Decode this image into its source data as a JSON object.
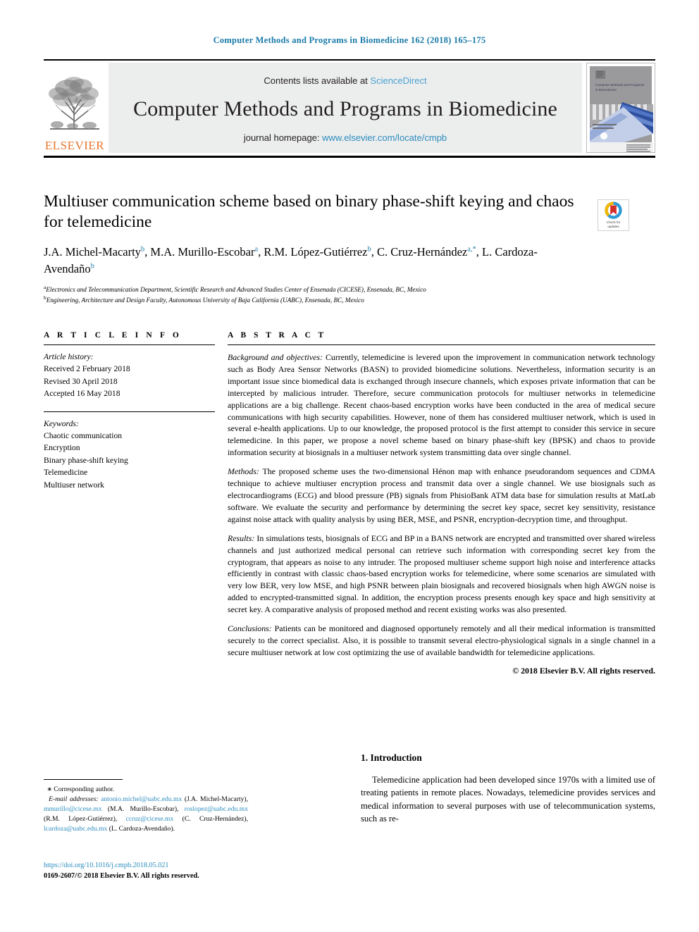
{
  "running_head": "Computer Methods and Programs in Biomedicine 162 (2018) 165–175",
  "masthead": {
    "contents_prefix": "Contents lists available at ",
    "sciencedirect": "ScienceDirect",
    "journal_title": "Computer Methods and Programs in Biomedicine",
    "homepage_prefix": "journal homepage: ",
    "homepage_url": "www.elsevier.com/locate/cmpb",
    "publisher": "ELSEVIER",
    "cover_title": "Computer Methods and Programs in Biomedicine"
  },
  "crossmark": {
    "line1": "Check for",
    "line2": "updates"
  },
  "article": {
    "title": "Multiuser communication scheme based on binary phase-shift keying and chaos for telemedicine",
    "authors_html": "J.A. Michel-Macarty<sup>b</sup>, M.A. Murillo-Escobar<sup>a</sup>, R.M. López-Gutiérrez<sup>b</sup>, C. Cruz-Hernández<sup>a,</sup><sup>*</sup>, L. Cardoza-Avendaño<sup>b</sup>",
    "affiliation_a": "Electronics and Telecommunication Department, Scientific Research and Advanced Studies Center of Ensenada (CICESE), Ensenada, BC, Mexico",
    "affiliation_b": "Engineering, Architecture and Design Faculty, Autonomous University of Baja California (UABC), Ensenada, BC, Mexico"
  },
  "info": {
    "heading": "A R T I C L E  I N F O",
    "history_label": "Article history:",
    "history": [
      "Received 2 February 2018",
      "Revised 30 April 2018",
      "Accepted 16 May 2018"
    ],
    "keywords_label": "Keywords:",
    "keywords": [
      "Chaotic communication",
      "Encryption",
      "Binary phase-shift keying",
      "Telemedicine",
      "Multiuser network"
    ]
  },
  "abstract": {
    "heading": "A B S T R A C T",
    "background_label": "Background and objectives:",
    "background_text": "  Currently, telemedicine is levered upon the improvement in communication network technology such as Body Area Sensor Networks (BASN) to provided biomedicine solutions. Nevertheless, information security is an important issue since biomedical data is exchanged through insecure channels, which exposes private information that can be intercepted by malicious intruder. Therefore, secure communication protocols for multiuser networks in telemedicine applications are a big challenge. Recent chaos-based encryption works have been conducted in the area of medical secure communications with high security capabilities. However, none of them has considered multiuser network, which is used in several e-health applications. Up to our knowledge, the proposed protocol is the first attempt to consider this service in secure telemedicine. In this paper, we propose a novel scheme based on binary phase-shift key (BPSK) and chaos to provide information security at biosignals in a multiuser network system transmitting data over single channel.",
    "methods_label": "Methods:",
    "methods_text": "  The proposed scheme uses the two-dimensional Hénon map with enhance pseudorandom sequences and CDMA technique to achieve multiuser encryption process and transmit data over a single channel. We use biosignals such as electrocardiograms (ECG) and blood pressure (PB) signals from PhisioBank ATM data base for simulation results at MatLab software. We evaluate the security and performance by determining the secret key space, secret key sensitivity, resistance against noise attack with quality analysis by using BER, MSE, and PSNR, encryption-decryption time, and throughput.",
    "results_label": "Results:",
    "results_text": "  In simulations tests, biosignals of ECG and BP in a BANS network are encrypted and transmitted over shared wireless channels and just authorized medical personal can retrieve such information with corresponding secret key from the cryptogram, that appears as noise to any intruder. The proposed multiuser scheme support high noise and interference attacks efficiently in contrast with classic chaos-based encryption works for telemedicine, where some scenarios are simulated with very low BER, very low MSE, and high PSNR between plain biosignals and recovered biosignals when high AWGN noise is added to encrypted-transmitted signal. In addition, the encryption process presents enough key space and high sensitivity at secret key. A comparative analysis of proposed method and recent existing works was also presented.",
    "conclusions_label": "Conclusions:",
    "conclusions_text": "  Patients can be monitored and diagnosed opportunely remotely and all their medical information is transmitted securely to the correct specialist. Also, it is possible to transmit several electro-physiological signals in a single channel in a secure multiuser network at low cost optimizing the use of available bandwidth for telemedicine applications.",
    "copyright": "© 2018 Elsevier B.V. All rights reserved."
  },
  "footnote": {
    "corresponding": "Corresponding author.",
    "email_label": "E-mail addresses:",
    "emails": [
      {
        "address": "antonio.michel@uabc.edu.mx",
        "name": "(J.A. Michel-Macarty)"
      },
      {
        "address": "mmurillo@cicese.mx",
        "name": "(M.A. Murillo-Escobar)"
      },
      {
        "address": "roslopez@uabc.edu.mx",
        "name": "(R.M. López-Gutiérrez)"
      },
      {
        "address": "ccruz@cicese.mx",
        "name": "(C. Cruz-Hernández)"
      },
      {
        "address": "lcardoza@uabc.edu.mx",
        "name": "(L. Cardoza-Avendaño)"
      }
    ],
    "doi": "https://doi.org/10.1016/j.cmpb.2018.05.021",
    "issn": "0169-2607/© 2018 Elsevier B.V. All rights reserved."
  },
  "introduction": {
    "heading": "1. Introduction",
    "paragraph": "Telemedicine application had been developed since 1970s with a limited use of treating patients in remote places. Nowadays, telemedicine provides services and medical information to several purposes with use of telecommunication systems, such as re-"
  },
  "colors": {
    "link": "#2b8cbe",
    "running_head": "#1a7aa8",
    "elsevier_orange": "#e8762c",
    "banner_bg": "#eceded"
  }
}
